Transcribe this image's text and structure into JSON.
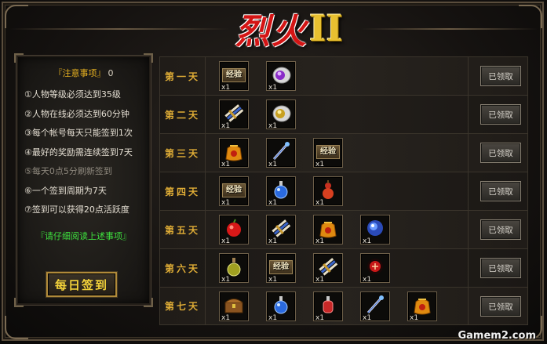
{
  "title": {
    "main": "烈火",
    "numeral": "II"
  },
  "notice": {
    "header": "『注意事项』",
    "count": "0",
    "items": [
      "①人物等级必须达到35级",
      "②人物在线必须达到60分钟",
      "③每个帐号每天只能签到1次",
      "④最好的奖励需连续签到7天",
      "⑤每天0点5分刷新签到",
      "⑥一个签到周期为7天",
      "⑦签到可以获得20点活跃度"
    ],
    "footer": "『请仔细阅读上述事项』",
    "sign_button": "每日签到"
  },
  "days": [
    {
      "label": "第一天",
      "claim": "已领取",
      "items": [
        {
          "icon": "exp-scroll",
          "text": "经验",
          "qty": "x1"
        },
        {
          "icon": "purple-orb-bag",
          "qty": "x1"
        }
      ]
    },
    {
      "label": "第二天",
      "claim": "已领取",
      "items": [
        {
          "icon": "scroll-bundle",
          "qty": "x1"
        },
        {
          "icon": "gold-orb-bag",
          "qty": "x1"
        }
      ]
    },
    {
      "label": "第三天",
      "claim": "已领取",
      "items": [
        {
          "icon": "treasure-pouch",
          "qty": "x1"
        },
        {
          "icon": "magic-wand",
          "qty": "x1"
        },
        {
          "icon": "exp-scroll",
          "text": "经验",
          "qty": "x1"
        }
      ]
    },
    {
      "label": "第四天",
      "claim": "已领取",
      "items": [
        {
          "icon": "exp-scroll",
          "text": "经验",
          "qty": "x1"
        },
        {
          "icon": "blue-potion",
          "qty": "x1"
        },
        {
          "icon": "red-gourd",
          "qty": "x1"
        }
      ]
    },
    {
      "label": "第五天",
      "claim": "已领取",
      "items": [
        {
          "icon": "red-apple",
          "qty": "x1"
        },
        {
          "icon": "scroll-bundle",
          "qty": "x1"
        },
        {
          "icon": "treasure-pouch",
          "qty": "x1"
        },
        {
          "icon": "blue-orb",
          "qty": "x1"
        }
      ]
    },
    {
      "label": "第六天",
      "claim": "已领取",
      "items": [
        {
          "icon": "green-potion",
          "qty": "x1"
        },
        {
          "icon": "exp-scroll",
          "text": "经验",
          "qty": "x1"
        },
        {
          "icon": "scroll-bundle",
          "qty": "x1"
        },
        {
          "icon": "red-rune-orb",
          "qty": "x1"
        }
      ]
    },
    {
      "label": "第七天",
      "claim": "已领取",
      "items": [
        {
          "icon": "treasure-chest",
          "qty": "x1"
        },
        {
          "icon": "blue-potion",
          "qty": "x1"
        },
        {
          "icon": "red-potion",
          "qty": "x1"
        },
        {
          "icon": "magic-wand",
          "qty": "x1"
        },
        {
          "icon": "treasure-pouch",
          "qty": "x1"
        }
      ]
    }
  ],
  "watermark": "Gamem2.com"
}
